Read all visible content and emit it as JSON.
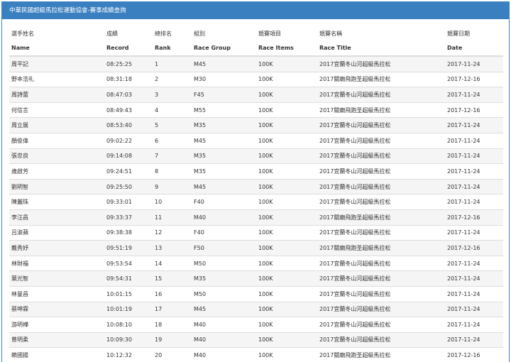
{
  "header": {
    "title": "中華民國超級馬拉松運動協會-賽事成績查詢"
  },
  "columns": {
    "zh": [
      "選手姓名",
      "成績",
      "總排名",
      "組別",
      "競賽項目",
      "競賽名稱",
      "競賽日期"
    ],
    "en": [
      "Name",
      "Record",
      "Rank",
      "Race Group",
      "Race Items",
      "Race Title",
      "Date"
    ]
  },
  "rows": [
    [
      "周平記",
      "08:25:25",
      "1",
      "M45",
      "100K",
      "2017宜蘭冬山河超級馬拉松",
      "2017-11-24"
    ],
    [
      "野本浩礼",
      "08:31:18",
      "2",
      "M30",
      "100K",
      "2017關廟飛跑圣超級馬拉松",
      "2017-12-16"
    ],
    [
      "周詩蕾",
      "08:47:03",
      "3",
      "F45",
      "100K",
      "2017宜蘭冬山河超級馬拉松",
      "2017-11-24"
    ],
    [
      "何信言",
      "08:49:43",
      "4",
      "M55",
      "100K",
      "2017關廟飛跑圣超級馬拉松",
      "2017-12-16"
    ],
    [
      "周立展",
      "08:53:40",
      "5",
      "M35",
      "100K",
      "2017宜蘭冬山河超級馬拉松",
      "2017-11-24"
    ],
    [
      "顏俊偉",
      "09:02:22",
      "6",
      "M45",
      "100K",
      "2017宜蘭冬山河超級馬拉松",
      "2017-11-24"
    ],
    [
      "張忠良",
      "09:14:08",
      "7",
      "M35",
      "100K",
      "2017宜蘭冬山河超級馬拉松",
      "2017-11-24"
    ],
    [
      "歲啟芳",
      "09:24:51",
      "8",
      "M35",
      "100K",
      "2017宜蘭冬山河超級馬拉松",
      "2017-11-24"
    ],
    [
      "劉明智",
      "09:25:50",
      "9",
      "M45",
      "100K",
      "2017宜蘭冬山河超級馬拉松",
      "2017-11-24"
    ],
    [
      "陳麗珠",
      "09:33:01",
      "10",
      "F40",
      "100K",
      "2017宜蘭冬山河超級馬拉松",
      "2017-11-24"
    ],
    [
      "李汪昌",
      "09:33:37",
      "11",
      "M40",
      "100K",
      "2017關廟飛跑圣超級馬拉松",
      "2017-12-16"
    ],
    [
      "吕淑蘋",
      "09:38:38",
      "12",
      "F40",
      "100K",
      "2017宜蘭冬山河超級馬拉松",
      "2017-11-24"
    ],
    [
      "戴秀妤",
      "09:51:19",
      "13",
      "F50",
      "100K",
      "2017關廟飛跑圣超級馬拉松",
      "2017-12-16"
    ],
    [
      "林財福",
      "09:53:54",
      "14",
      "M50",
      "100K",
      "2017宜蘭冬山河超級馬拉松",
      "2017-11-24"
    ],
    [
      "葉光智",
      "09:54:31",
      "15",
      "M35",
      "100K",
      "2017宜蘭冬山河超級馬拉松",
      "2017-11-24"
    ],
    [
      "林曼昌",
      "10:01:15",
      "16",
      "M50",
      "100K",
      "2017宜蘭冬山河超級馬拉松",
      "2017-11-24"
    ],
    [
      "蔡坤霖",
      "10:01:19",
      "17",
      "M45",
      "100K",
      "2017宜蘭冬山河超級馬拉松",
      "2017-11-24"
    ],
    [
      "游明樺",
      "10:08:10",
      "18",
      "M40",
      "100K",
      "2017宜蘭冬山河超級馬拉松",
      "2017-11-24"
    ],
    [
      "曾明柔",
      "10:09:30",
      "19",
      "M40",
      "100K",
      "2017宜蘭冬山河超級馬拉松",
      "2017-11-24"
    ],
    [
      "賴國揚",
      "10:12:32",
      "20",
      "M40",
      "100K",
      "2017關廟飛跑圣超級馬拉松",
      "2017-12-16"
    ]
  ],
  "colors": {
    "heading_bg": "#3a7fbf",
    "heading_text": "#ffffff",
    "stripe": "#f5f5f5",
    "border": "#dddddd"
  }
}
